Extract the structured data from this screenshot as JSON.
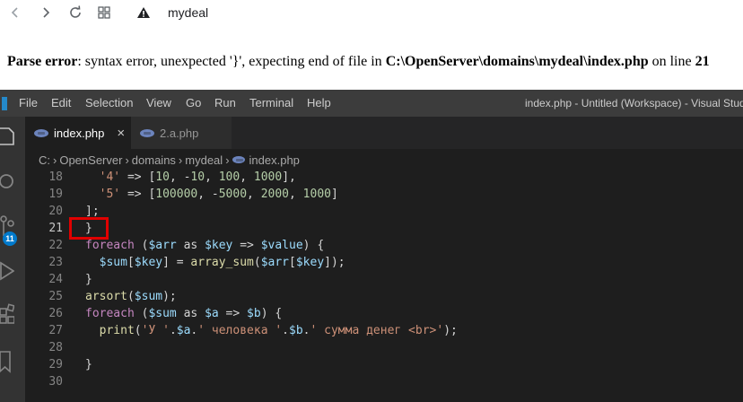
{
  "browser": {
    "address": "mydeal"
  },
  "error": {
    "label": "Parse error",
    "message": ": syntax error, unexpected '}', expecting end of file in ",
    "path": "C:\\OpenServer\\domains\\mydeal\\index.php",
    "on_line": " on line ",
    "line": "21"
  },
  "vscode": {
    "menu": [
      "File",
      "Edit",
      "Selection",
      "View",
      "Go",
      "Run",
      "Terminal",
      "Help"
    ],
    "window_title": "index.php - Untitled (Workspace) - Visual Stud",
    "tabs": [
      {
        "label": "index.php",
        "active": true,
        "close": "×"
      },
      {
        "label": "2.a.php",
        "active": false
      }
    ],
    "breadcrumbs": [
      "C:",
      "OpenServer",
      "domains",
      "mydeal",
      "index.php"
    ],
    "breadcrumb_separator": "›",
    "source_control_badge": "11",
    "current_line": "21",
    "code_lines": [
      {
        "no": "18",
        "tokens": [
          {
            "t": "  ",
            "c": "plain"
          },
          {
            "t": "'4'",
            "c": "str"
          },
          {
            "t": " => [",
            "c": "plain"
          },
          {
            "t": "10",
            "c": "num"
          },
          {
            "t": ", -",
            "c": "plain"
          },
          {
            "t": "10",
            "c": "num"
          },
          {
            "t": ", ",
            "c": "plain"
          },
          {
            "t": "100",
            "c": "num"
          },
          {
            "t": ", ",
            "c": "plain"
          },
          {
            "t": "1000",
            "c": "num"
          },
          {
            "t": "],",
            "c": "plain"
          }
        ]
      },
      {
        "no": "19",
        "tokens": [
          {
            "t": "  ",
            "c": "plain"
          },
          {
            "t": "'5'",
            "c": "str"
          },
          {
            "t": " => [",
            "c": "plain"
          },
          {
            "t": "100000",
            "c": "num"
          },
          {
            "t": ", -",
            "c": "plain"
          },
          {
            "t": "5000",
            "c": "num"
          },
          {
            "t": ", ",
            "c": "plain"
          },
          {
            "t": "2000",
            "c": "num"
          },
          {
            "t": ", ",
            "c": "plain"
          },
          {
            "t": "1000",
            "c": "num"
          },
          {
            "t": "]",
            "c": "plain"
          }
        ]
      },
      {
        "no": "20",
        "tokens": [
          {
            "t": "];",
            "c": "plain"
          }
        ]
      },
      {
        "no": "21",
        "tokens": [
          {
            "t": "}",
            "c": "plain"
          }
        ]
      },
      {
        "no": "22",
        "tokens": [
          {
            "t": "foreach",
            "c": "kw"
          },
          {
            "t": " (",
            "c": "plain"
          },
          {
            "t": "$arr",
            "c": "var"
          },
          {
            "t": " as ",
            "c": "plain"
          },
          {
            "t": "$key",
            "c": "var"
          },
          {
            "t": " => ",
            "c": "plain"
          },
          {
            "t": "$value",
            "c": "var"
          },
          {
            "t": ") {",
            "c": "plain"
          }
        ]
      },
      {
        "no": "23",
        "tokens": [
          {
            "t": "  ",
            "c": "plain"
          },
          {
            "t": "$sum",
            "c": "var"
          },
          {
            "t": "[",
            "c": "plain"
          },
          {
            "t": "$key",
            "c": "var"
          },
          {
            "t": "] = ",
            "c": "plain"
          },
          {
            "t": "array_sum",
            "c": "fn"
          },
          {
            "t": "(",
            "c": "plain"
          },
          {
            "t": "$arr",
            "c": "var"
          },
          {
            "t": "[",
            "c": "plain"
          },
          {
            "t": "$key",
            "c": "var"
          },
          {
            "t": "]);",
            "c": "plain"
          }
        ]
      },
      {
        "no": "24",
        "tokens": [
          {
            "t": "}",
            "c": "plain"
          }
        ]
      },
      {
        "no": "25",
        "tokens": [
          {
            "t": "arsort",
            "c": "fn"
          },
          {
            "t": "(",
            "c": "plain"
          },
          {
            "t": "$sum",
            "c": "var"
          },
          {
            "t": ");",
            "c": "plain"
          }
        ]
      },
      {
        "no": "26",
        "tokens": [
          {
            "t": "foreach",
            "c": "kw"
          },
          {
            "t": " (",
            "c": "plain"
          },
          {
            "t": "$sum",
            "c": "var"
          },
          {
            "t": " as ",
            "c": "plain"
          },
          {
            "t": "$a",
            "c": "var"
          },
          {
            "t": " => ",
            "c": "plain"
          },
          {
            "t": "$b",
            "c": "var"
          },
          {
            "t": ") {",
            "c": "plain"
          }
        ]
      },
      {
        "no": "27",
        "tokens": [
          {
            "t": "  ",
            "c": "plain"
          },
          {
            "t": "print",
            "c": "fn"
          },
          {
            "t": "(",
            "c": "plain"
          },
          {
            "t": "'У '",
            "c": "str"
          },
          {
            "t": ".",
            "c": "plain"
          },
          {
            "t": "$a",
            "c": "var"
          },
          {
            "t": ".",
            "c": "plain"
          },
          {
            "t": "' человека '",
            "c": "str"
          },
          {
            "t": ".",
            "c": "plain"
          },
          {
            "t": "$b",
            "c": "var"
          },
          {
            "t": ".",
            "c": "plain"
          },
          {
            "t": "' сумма денег <br>'",
            "c": "str"
          },
          {
            "t": ");",
            "c": "plain"
          }
        ]
      },
      {
        "no": "28",
        "tokens": []
      },
      {
        "no": "29",
        "tokens": [
          {
            "t": "}",
            "c": "plain"
          }
        ]
      },
      {
        "no": "30",
        "tokens": []
      }
    ]
  }
}
